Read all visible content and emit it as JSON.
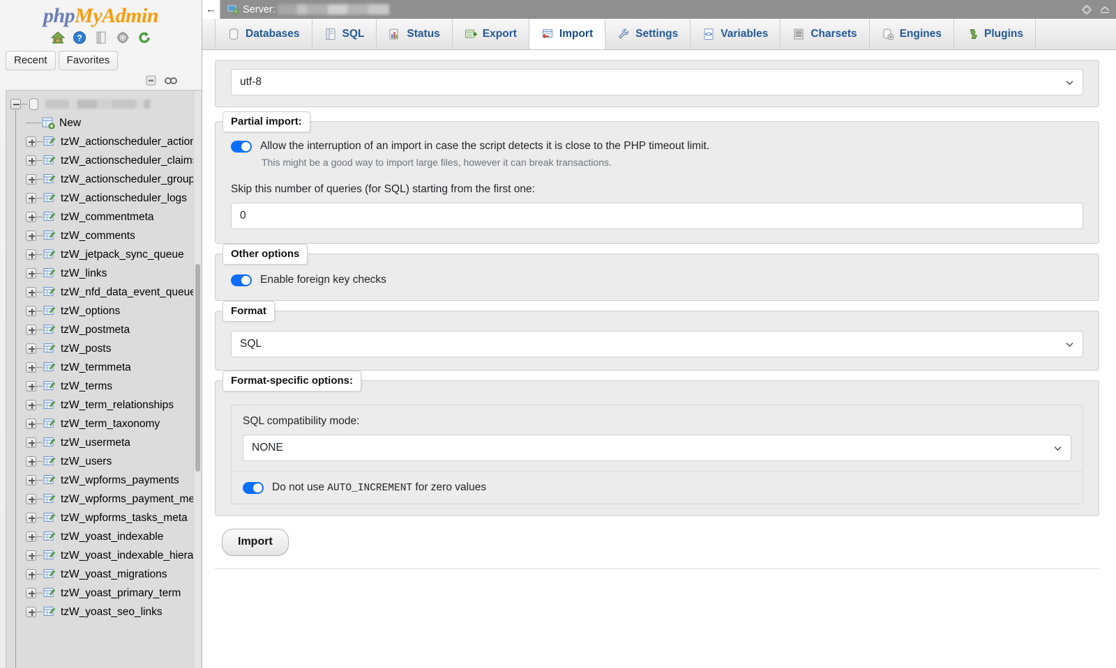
{
  "app": {
    "logo_php": "php",
    "logo_my": "My",
    "logo_admin": "Admin",
    "logo_icons": [
      "home-icon",
      "help-icon",
      "docs-icon",
      "settings-icon",
      "refresh-icon"
    ]
  },
  "sidebar": {
    "quick_tabs": [
      {
        "label": "Recent",
        "name": "recent-tab"
      },
      {
        "label": "Favorites",
        "name": "favorites-tab"
      }
    ],
    "tools": [
      "collapse-all-icon",
      "link-tables-icon"
    ],
    "database_name": "",
    "database_redacted": true,
    "new_label": "New",
    "tables": [
      "tzW_actionscheduler_actions",
      "tzW_actionscheduler_claims",
      "tzW_actionscheduler_groups",
      "tzW_actionscheduler_logs",
      "tzW_commentmeta",
      "tzW_comments",
      "tzW_jetpack_sync_queue",
      "tzW_links",
      "tzW_nfd_data_event_queue",
      "tzW_options",
      "tzW_postmeta",
      "tzW_posts",
      "tzW_termmeta",
      "tzW_terms",
      "tzW_term_relationships",
      "tzW_term_taxonomy",
      "tzW_usermeta",
      "tzW_users",
      "tzW_wpforms_payments",
      "tzW_wpforms_payment_meta",
      "tzW_wpforms_tasks_meta",
      "tzW_yoast_indexable",
      "tzW_yoast_indexable_hierarc",
      "tzW_yoast_migrations",
      "tzW_yoast_primary_term",
      "tzW_yoast_seo_links"
    ]
  },
  "topbar": {
    "back_arrow": "←",
    "server_label": "Server:",
    "server_name_redacted": true,
    "right_icons": [
      "settings-gear-icon",
      "collapse-icon"
    ]
  },
  "tabs": [
    {
      "label": "Databases",
      "icon": "database-icon",
      "active": false
    },
    {
      "label": "SQL",
      "icon": "sql-icon",
      "active": false
    },
    {
      "label": "Status",
      "icon": "status-chart-icon",
      "active": false
    },
    {
      "label": "Export",
      "icon": "export-icon",
      "active": false
    },
    {
      "label": "Import",
      "icon": "import-icon",
      "active": true
    },
    {
      "label": "Settings",
      "icon": "wrench-icon",
      "active": false
    },
    {
      "label": "Variables",
      "icon": "variables-icon",
      "active": false
    },
    {
      "label": "Charsets",
      "icon": "charsets-icon",
      "active": false
    },
    {
      "label": "Engines",
      "icon": "engines-icon",
      "active": false
    },
    {
      "label": "Plugins",
      "icon": "plugins-puzzle-icon",
      "active": false
    }
  ],
  "main": {
    "charset": {
      "value": "utf-8"
    },
    "partial_import": {
      "legend": "Partial import:",
      "allow_interrupt_label": "Allow the interruption of an import in case the script detects it is close to the PHP timeout limit.",
      "allow_interrupt_on": true,
      "allow_interrupt_note": "This might be a good way to import large files, however it can break transactions.",
      "skip_label": "Skip this number of queries (for SQL) starting from the first one:",
      "skip_value": "0"
    },
    "other_options": {
      "legend": "Other options",
      "fk_label": "Enable foreign key checks",
      "fk_on": true
    },
    "format": {
      "legend": "Format",
      "value": "SQL"
    },
    "format_specific": {
      "legend": "Format-specific options:",
      "compat_label": "SQL compatibility mode:",
      "compat_value": "NONE",
      "auto_increment_prefix": "Do not use ",
      "auto_increment_mono": "AUTO_INCREMENT",
      "auto_increment_suffix": " for zero values",
      "auto_increment_on": true
    },
    "submit_label": "Import"
  },
  "colors": {
    "accent_blue": "#0d6efd",
    "tab_text": "#235a97",
    "topbar_bg": "#8f8f8f",
    "panel_bg": "#ececec",
    "logo_orange": "#f89c0e",
    "logo_blue": "#6c7eb7"
  }
}
